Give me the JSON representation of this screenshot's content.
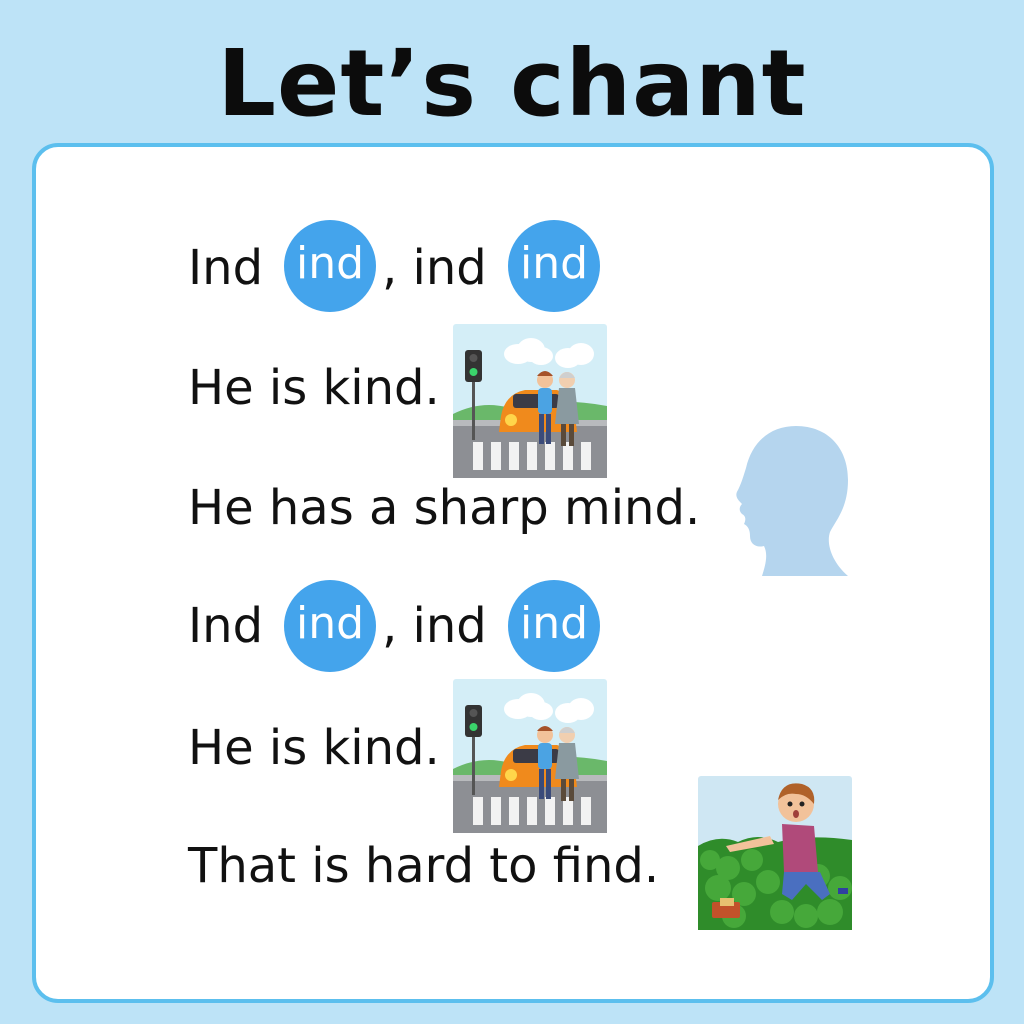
{
  "title": "Let’s chant",
  "lines": {
    "l1": {
      "pre": "Ind",
      "mid": ", ind",
      "bubble1": "ind",
      "bubble2": "ind"
    },
    "l2": "He is kind.",
    "l3": "He has a sharp mind.",
    "l4": {
      "pre": "Ind",
      "mid": ", ind",
      "bubble1": "ind",
      "bubble2": "ind"
    },
    "l5": "He is kind.",
    "l6": "That is hard to find."
  },
  "colors": {
    "background": "#bde3f7",
    "border": "#5cbfee",
    "bubble": "#44a4ec",
    "head": "#b5d5ee"
  },
  "icons": [
    "crosswalk-kind-boy-illustration",
    "head-silhouette-icon",
    "boy-finding-wallet-illustration"
  ]
}
